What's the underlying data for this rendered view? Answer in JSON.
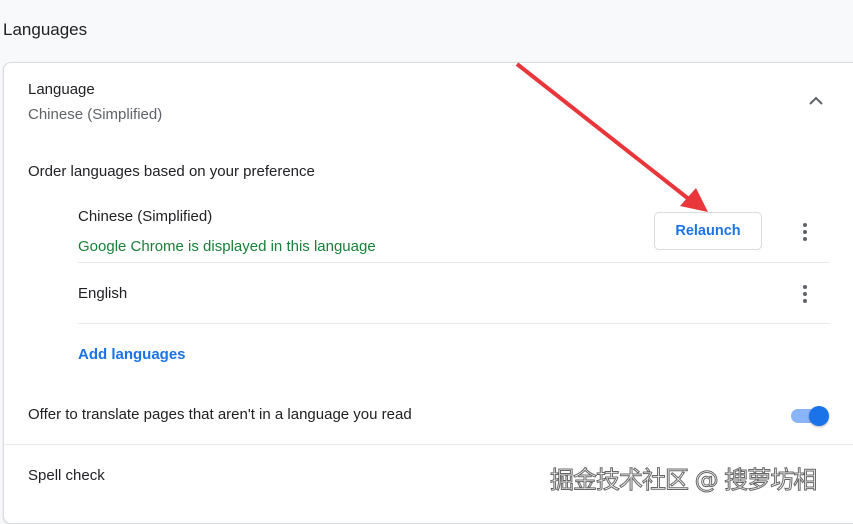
{
  "header": {
    "title": "Languages"
  },
  "language": {
    "label": "Language",
    "value": "Chinese (Simplified)"
  },
  "order_label": "Order languages based on your preference",
  "languages": [
    {
      "name": "Chinese (Simplified)",
      "note": "Google Chrome is displayed in this language",
      "action": "Relaunch"
    },
    {
      "name": "English"
    }
  ],
  "add_languages": "Add languages",
  "offer_translate": {
    "label": "Offer to translate pages that aren't in a language you read",
    "enabled": true
  },
  "spell_check": "Spell check",
  "watermark": "掘金技术社区 @ 搜萝坊相",
  "colors": {
    "accent": "#1a73e8",
    "green": "#188038",
    "arrow": "#e8363a"
  }
}
